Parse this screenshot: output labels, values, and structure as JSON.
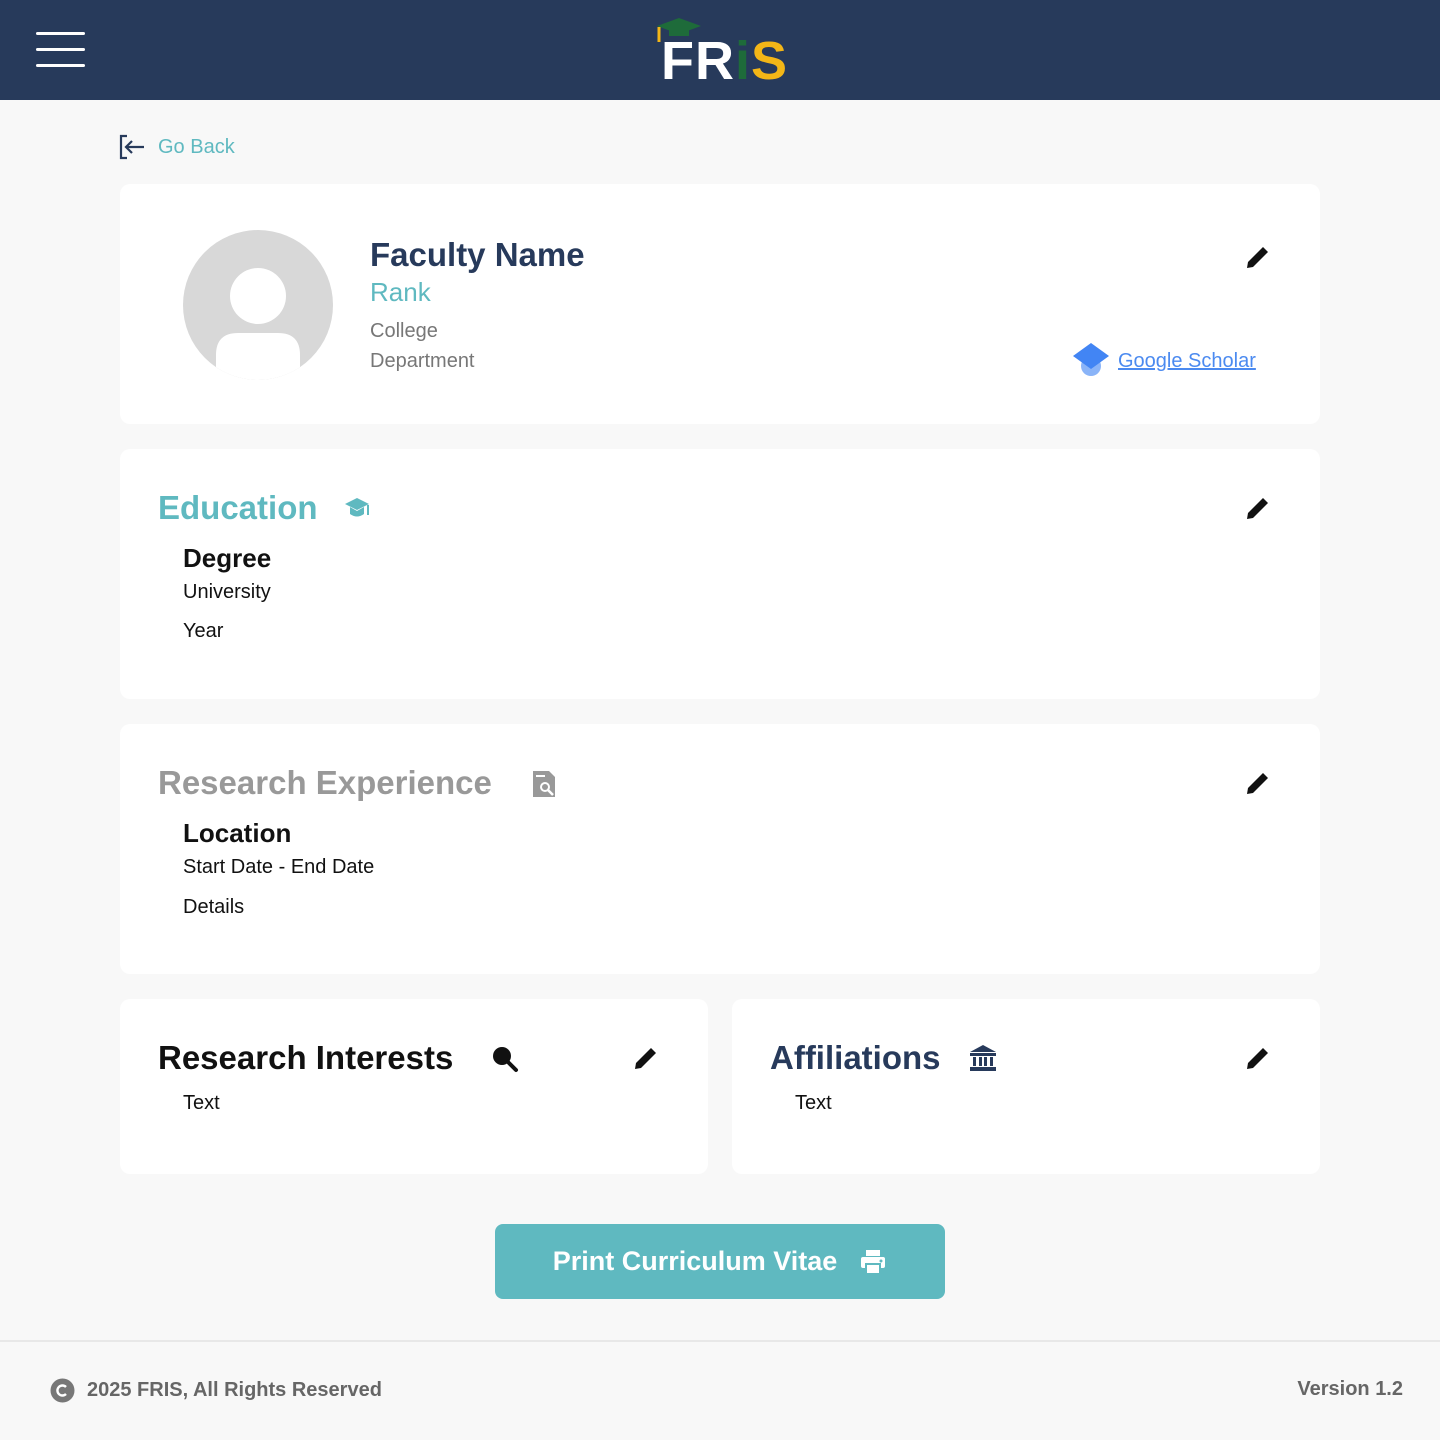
{
  "header": {
    "logo": {
      "part1": "FR",
      "part2": "i",
      "part3": "S"
    }
  },
  "nav": {
    "go_back_label": "Go Back"
  },
  "profile": {
    "name": "Faculty Name",
    "rank": "Rank",
    "college": "College",
    "department": "Department",
    "scholar_link": "Google Scholar"
  },
  "education": {
    "title": "Education",
    "degree": "Degree",
    "university": "University",
    "year": "Year"
  },
  "research_experience": {
    "title": "Research Experience",
    "location": "Location",
    "dates": "Start Date - End Date",
    "details": "Details"
  },
  "research_interests": {
    "title": "Research Interests",
    "text": "Text"
  },
  "affiliations": {
    "title": "Affiliations",
    "text": "Text"
  },
  "actions": {
    "print_label": "Print Curriculum Vitae"
  },
  "footer": {
    "copyright": "2025 FRIS, All Rights Reserved",
    "version": "Version 1.2"
  },
  "colors": {
    "topbar": "#273a5b",
    "accent": "#5fb9c0",
    "navy": "#273a5b",
    "link": "#4b8af0",
    "muted": "#777777",
    "logo_green": "#1e6b3a",
    "logo_yellow": "#f3b617"
  },
  "icons": [
    "menu-icon",
    "logo-cap-icon",
    "back-arrow-icon",
    "avatar-icon",
    "edit-icon",
    "google-scholar-icon",
    "graduation-cap-icon",
    "document-search-icon",
    "search-icon",
    "institution-icon",
    "printer-icon",
    "copyright-icon"
  ]
}
